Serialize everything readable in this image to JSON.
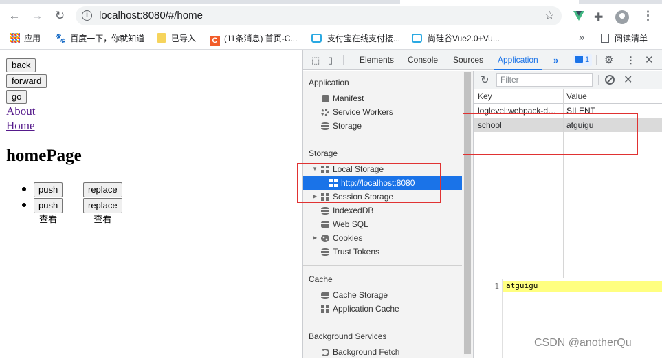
{
  "browser": {
    "url": "localhost:8080/#/home",
    "bookmarks": [
      {
        "label": "应用"
      },
      {
        "label": "百度一下，你就知道"
      },
      {
        "label": "已导入"
      },
      {
        "label": "(11条消息) 首页-C..."
      },
      {
        "label": "支付宝在线支付接..."
      },
      {
        "label": "尚硅谷Vue2.0+Vu..."
      }
    ],
    "more": "»",
    "reading_list": "阅读清单"
  },
  "page": {
    "buttons": {
      "back": "back",
      "forward": "forward",
      "go": "go"
    },
    "links": {
      "about": "About",
      "home": "Home"
    },
    "title": "homePage",
    "list": [
      {
        "push": "push查看",
        "replace": "replace查看"
      },
      {
        "push": "push查看",
        "replace": "replace查看"
      }
    ]
  },
  "devtools": {
    "tabs": [
      "Elements",
      "Console",
      "Sources",
      "Application"
    ],
    "active_tab": "Application",
    "message_count": "1",
    "sidebar": {
      "application_header": "Application",
      "application_items": [
        "Manifest",
        "Service Workers",
        "Storage"
      ],
      "storage_header": "Storage",
      "local_storage": "Local Storage",
      "local_storage_origin": "http://localhost:8080",
      "session_storage": "Session Storage",
      "storage_items": [
        "IndexedDB",
        "Web SQL",
        "Cookies",
        "Trust Tokens"
      ],
      "cache_header": "Cache",
      "cache_items": [
        "Cache Storage",
        "Application Cache"
      ],
      "background_header": "Background Services",
      "background_items": [
        "Background Fetch"
      ]
    },
    "storage": {
      "filter_placeholder": "Filter",
      "columns": {
        "key": "Key",
        "value": "Value"
      },
      "rows": [
        {
          "key": "loglevel:webpack-dev-server",
          "value": "SILENT"
        },
        {
          "key": "school",
          "value": "atguigu"
        }
      ],
      "selected_row": 1,
      "preview": {
        "line_number": "1",
        "text": "atguigu"
      }
    }
  },
  "watermark": "CSDN @anotherQu",
  "colors": {
    "accent": "#1a73e8",
    "highlight_box": "#e03232",
    "preview_highlight": "#ffff80"
  }
}
